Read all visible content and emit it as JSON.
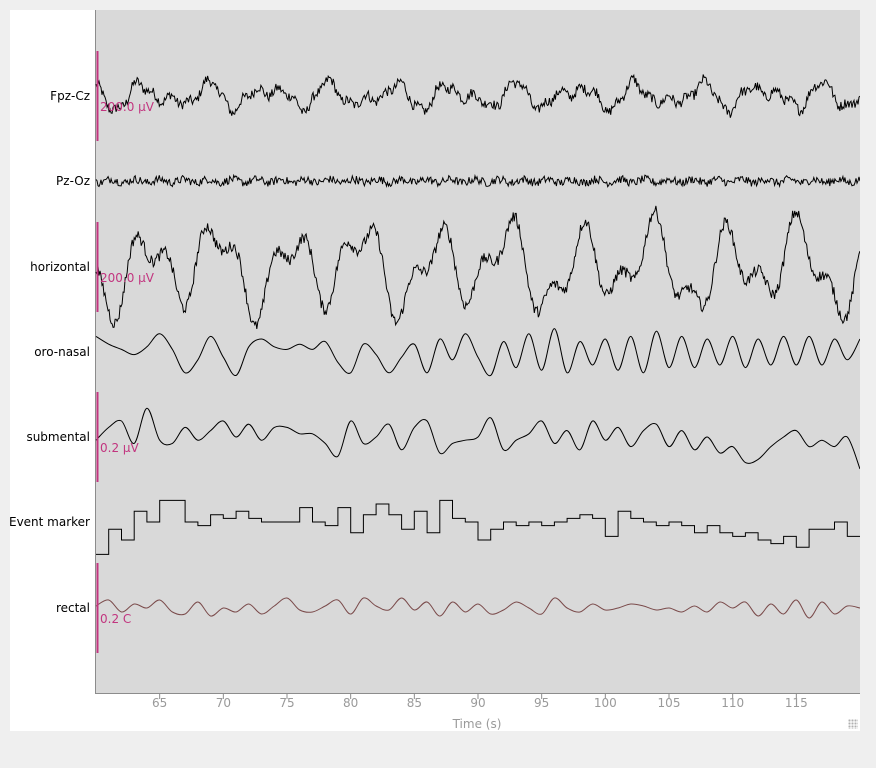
{
  "chart_data": {
    "type": "line",
    "title": "",
    "xlabel": "Time (s)",
    "ylabel": "",
    "xlim": [
      60.0,
      120.0
    ],
    "xticks": [
      65,
      70,
      75,
      80,
      85,
      90,
      95,
      100,
      105,
      110,
      115
    ],
    "grid": false,
    "colors": {
      "plot_background": "#d9d9d9",
      "trace": "#000000",
      "rectal_trace": "#7a4a4a",
      "rectal_label": "#5a2020",
      "scale_bar": "#c2357f",
      "tick_text": "#9a9a9a"
    },
    "channels": [
      {
        "name": "Fpz-Cz",
        "kind": "eeg",
        "scale_label": "200.0 µV"
      },
      {
        "name": "Pz-Oz",
        "kind": "eeg",
        "scale_label": ""
      },
      {
        "name": "horizontal",
        "kind": "eog",
        "scale_label": "200.0 µV"
      },
      {
        "name": "oro-nasal",
        "kind": "resp",
        "scale_label": ""
      },
      {
        "name": "submental",
        "kind": "emg",
        "scale_label": "0.2 µV"
      },
      {
        "name": "Event marker",
        "kind": "marker",
        "scale_label": ""
      },
      {
        "name": "rectal",
        "kind": "temp",
        "scale_label": "0.2 C"
      }
    ],
    "series": [
      {
        "name": "oro-nasal",
        "x": [
          60.0,
          61.0,
          62.0,
          63.0,
          64.0,
          65.0,
          66.0,
          67.0,
          68.0,
          69.0,
          70.0,
          71.0,
          72.0,
          73.0,
          74.0,
          75.0,
          76.0,
          77.0,
          78.0,
          79.0,
          80.0,
          81.0,
          82.0,
          83.0,
          84.0,
          85.0,
          86.0,
          87.0,
          88.0,
          89.0,
          90.0,
          91.0,
          92.0,
          93.0,
          94.0,
          95.0,
          96.0,
          97.0,
          98.0,
          99.0,
          100.0,
          101.0,
          102.0,
          103.0,
          104.0,
          105.0,
          106.0,
          107.0,
          108.0,
          109.0,
          110.0,
          111.0,
          112.0,
          113.0,
          114.0,
          115.0,
          116.0,
          117.0,
          118.0,
          119.0,
          120.0
        ],
        "y": [
          0.6,
          0.3,
          0.1,
          -0.1,
          0.2,
          0.7,
          0.1,
          -0.8,
          -0.3,
          0.6,
          -0.2,
          -0.9,
          0.2,
          0.5,
          0.2,
          0.1,
          0.3,
          0.1,
          0.4,
          -0.4,
          -0.8,
          0.3,
          -0.1,
          -0.8,
          -0.2,
          0.3,
          -0.8,
          0.5,
          -0.3,
          0.7,
          -0.2,
          -0.9,
          0.4,
          -0.6,
          0.7,
          -0.7,
          0.9,
          -0.8,
          0.4,
          -0.5,
          0.5,
          -0.7,
          0.6,
          -0.8,
          0.8,
          -0.6,
          0.6,
          -0.6,
          0.5,
          -0.5,
          0.6,
          -0.6,
          0.5,
          -0.5,
          0.6,
          -0.5,
          0.6,
          -0.5,
          0.5,
          -0.3,
          0.5
        ]
      },
      {
        "name": "submental",
        "x": [
          60.0,
          61.0,
          62.0,
          63.0,
          64.0,
          65.0,
          66.0,
          67.0,
          68.0,
          69.0,
          70.0,
          71.0,
          72.0,
          73.0,
          74.0,
          75.0,
          76.0,
          77.0,
          78.0,
          79.0,
          80.0,
          81.0,
          82.0,
          83.0,
          84.0,
          85.0,
          86.0,
          87.0,
          88.0,
          89.0,
          90.0,
          91.0,
          92.0,
          93.0,
          94.0,
          95.0,
          96.0,
          97.0,
          98.0,
          99.0,
          100.0,
          101.0,
          102.0,
          103.0,
          104.0,
          105.0,
          106.0,
          107.0,
          108.0,
          109.0,
          110.0,
          111.0,
          112.0,
          113.0,
          114.0,
          115.0,
          116.0,
          117.0,
          118.0,
          119.0,
          120.0
        ],
        "y": [
          -0.1,
          0.3,
          0.5,
          -0.2,
          0.9,
          -0.1,
          -0.2,
          0.3,
          -0.1,
          0.2,
          0.5,
          0.0,
          0.4,
          -0.1,
          0.3,
          0.3,
          0.1,
          0.1,
          -0.2,
          -0.6,
          0.5,
          -0.2,
          0.0,
          0.4,
          -0.4,
          0.3,
          0.5,
          -0.5,
          -0.2,
          -0.1,
          0.0,
          0.6,
          -0.4,
          -0.1,
          0.1,
          0.5,
          -0.2,
          0.2,
          -0.4,
          0.5,
          -0.1,
          0.3,
          -0.3,
          0.2,
          0.4,
          -0.3,
          0.2,
          -0.4,
          0.0,
          -0.5,
          -0.3,
          -0.8,
          -0.7,
          -0.3,
          0.0,
          0.2,
          -0.3,
          -0.1,
          -0.3,
          0.0,
          -1.0
        ]
      },
      {
        "name": "Event marker",
        "x": [
          60.0,
          61.0,
          62.0,
          63.0,
          64.0,
          65.0,
          66.0,
          67.0,
          68.0,
          69.0,
          70.0,
          71.0,
          72.0,
          73.0,
          74.0,
          75.0,
          76.0,
          77.0,
          78.0,
          79.0,
          80.0,
          81.0,
          82.0,
          83.0,
          84.0,
          85.0,
          86.0,
          87.0,
          88.0,
          89.0,
          90.0,
          91.0,
          92.0,
          93.0,
          94.0,
          95.0,
          96.0,
          97.0,
          98.0,
          99.0,
          100.0,
          101.0,
          102.0,
          103.0,
          104.0,
          105.0,
          106.0,
          107.0,
          108.0,
          109.0,
          110.0,
          111.0,
          112.0,
          113.0,
          114.0,
          115.0,
          116.0,
          117.0,
          118.0,
          119.0
        ],
        "y": [
          -0.9,
          -0.2,
          -0.5,
          0.3,
          0.0,
          0.6,
          0.6,
          0.0,
          -0.1,
          0.2,
          0.1,
          0.3,
          0.1,
          0.0,
          0.0,
          0.0,
          0.4,
          0.0,
          -0.1,
          0.4,
          -0.3,
          0.2,
          0.5,
          0.2,
          -0.2,
          0.3,
          -0.3,
          0.6,
          0.1,
          0.0,
          -0.5,
          -0.2,
          0.0,
          -0.1,
          0.0,
          -0.1,
          0.0,
          0.1,
          0.2,
          0.1,
          -0.4,
          0.3,
          0.1,
          0.0,
          -0.1,
          0.0,
          -0.1,
          -0.3,
          -0.1,
          -0.3,
          -0.4,
          -0.3,
          -0.5,
          -0.6,
          -0.4,
          -0.7,
          -0.2,
          -0.2,
          0.0,
          -0.4
        ]
      },
      {
        "name": "rectal",
        "x": [
          60.0,
          61.0,
          62.0,
          63.0,
          64.0,
          65.0,
          66.0,
          67.0,
          68.0,
          69.0,
          70.0,
          71.0,
          72.0,
          73.0,
          74.0,
          75.0,
          76.0,
          77.0,
          78.0,
          79.0,
          80.0,
          81.0,
          82.0,
          83.0,
          84.0,
          85.0,
          86.0,
          87.0,
          88.0,
          89.0,
          90.0,
          91.0,
          92.0,
          93.0,
          94.0,
          95.0,
          96.0,
          97.0,
          98.0,
          99.0,
          100.0,
          101.0,
          102.0,
          103.0,
          104.0,
          105.0,
          106.0,
          107.0,
          108.0,
          109.0,
          110.0,
          111.0,
          112.0,
          113.0,
          114.0,
          115.0,
          116.0,
          117.0,
          118.0,
          119.0,
          120.0
        ],
        "y": [
          0.1,
          0.4,
          -0.2,
          0.2,
          0.0,
          0.4,
          -0.2,
          -0.3,
          0.3,
          -0.4,
          0.0,
          -0.2,
          0.2,
          -0.3,
          0.1,
          0.5,
          -0.1,
          -0.2,
          0.1,
          0.4,
          -0.3,
          0.5,
          0.1,
          -0.1,
          0.5,
          -0.1,
          0.3,
          -0.4,
          0.3,
          -0.2,
          0.2,
          -0.3,
          -0.1,
          0.3,
          0.0,
          -0.3,
          0.5,
          0.0,
          -0.2,
          0.2,
          -0.1,
          0.0,
          0.2,
          0.1,
          -0.1,
          0.0,
          -0.2,
          0.1,
          -0.2,
          0.3,
          0.0,
          0.3,
          -0.4,
          0.2,
          -0.3,
          0.4,
          -0.5,
          0.3,
          -0.3,
          0.1,
          0.0
        ]
      }
    ]
  }
}
